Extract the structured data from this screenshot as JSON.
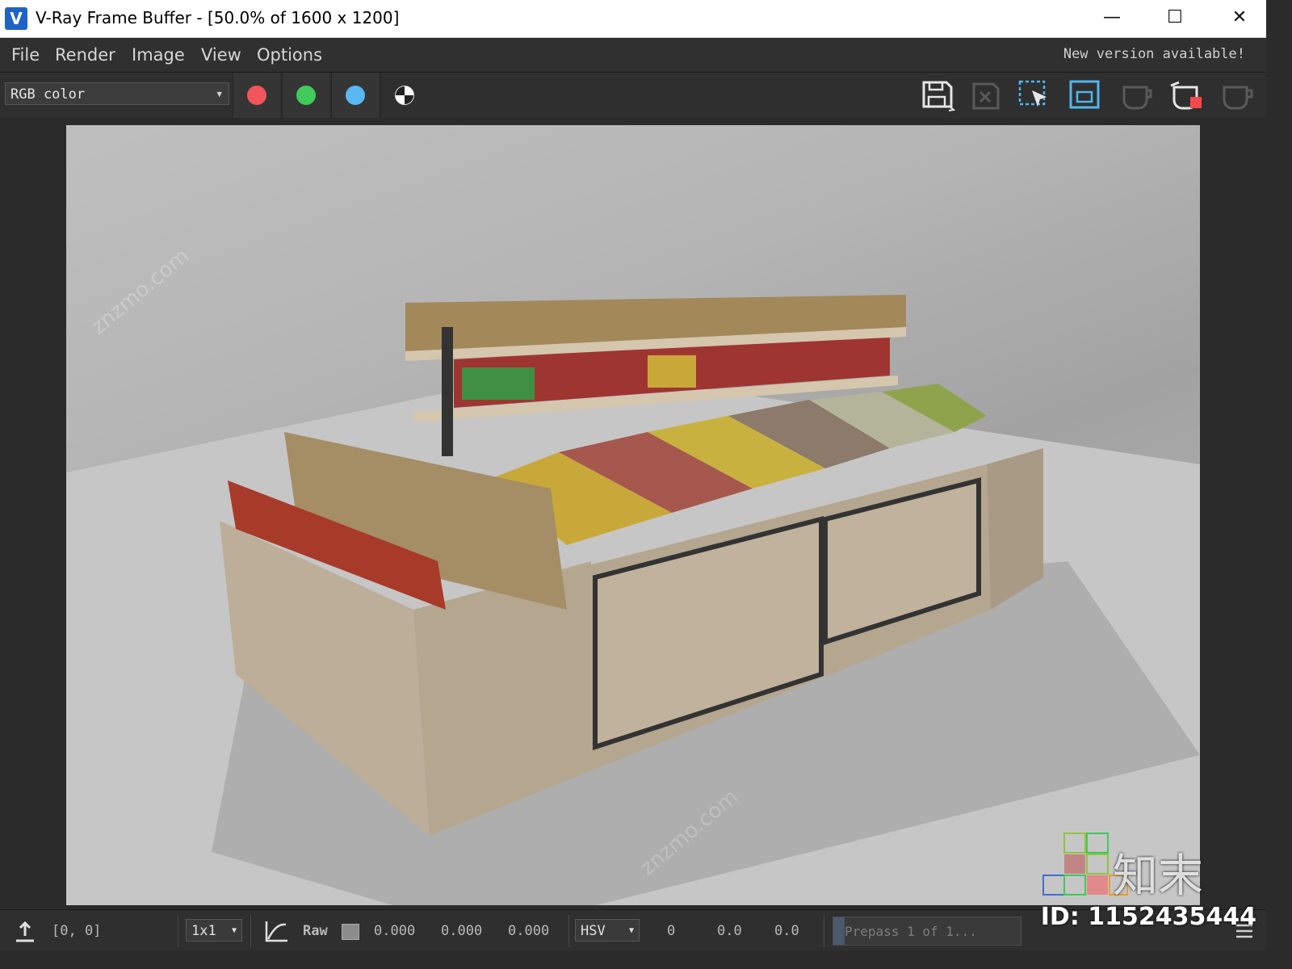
{
  "window": {
    "title": "V-Ray Frame Buffer - [50.0% of 1600 x 1200]",
    "logo_letter": "V",
    "controls": {
      "minimize": "—",
      "maximize": "☐",
      "close": "✕"
    }
  },
  "menu": {
    "items": [
      "File",
      "Render",
      "Image",
      "View",
      "Options"
    ],
    "update_notice": "New version available!"
  },
  "toolbar": {
    "channel_select": "RGB color",
    "channel_buttons": [
      {
        "name": "red-channel",
        "color": "#f2555a"
      },
      {
        "name": "green-channel",
        "color": "#3fca5a"
      },
      {
        "name": "blue-channel",
        "color": "#59b7f2"
      },
      {
        "name": "mono-channel",
        "color": "#ffffff"
      }
    ],
    "tools": [
      "save-icon",
      "clear-image-icon",
      "track-mouse-icon",
      "region-render-icon",
      "render-last-icon",
      "start-interactive-icon",
      "render-icon"
    ]
  },
  "colors": {
    "accent": "#1e62c6",
    "background": "#2b2b2b",
    "panel": "#303030"
  },
  "status": {
    "coords": "[0, 0]",
    "zoom_select": "1x1",
    "raw_label": "Raw",
    "rgb_values": [
      "0.000",
      "0.000",
      "0.000"
    ],
    "color_mode": "HSV",
    "hsv_values": [
      "0",
      "0.0",
      "0.0"
    ],
    "progress_text": "Prepass 1 of 1...",
    "progress": 0.06
  },
  "watermark": {
    "brand": "知末",
    "id": "ID: 1152435444"
  }
}
